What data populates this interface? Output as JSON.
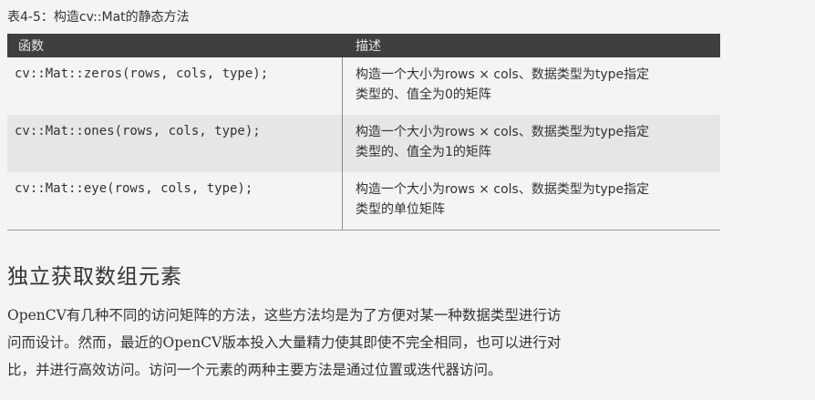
{
  "caption": "表4-5：构造cv::Mat的静态方法",
  "table": {
    "headers": [
      "函数",
      "描述"
    ],
    "rows": [
      {
        "func": "cv::Mat::zeros(rows, cols, type);",
        "desc1": "构造一个大小为rows × cols、数据类型为type指定",
        "desc2": "类型的、值全为0的矩阵"
      },
      {
        "func": "cv::Mat::ones(rows, cols, type);",
        "desc1": "构造一个大小为rows × cols、数据类型为type指定",
        "desc2": "类型的、值全为1的矩阵"
      },
      {
        "func": "cv::Mat::eye(rows, cols, type);",
        "desc1": "构造一个大小为rows × cols、数据类型为type指定",
        "desc2": "类型的单位矩阵"
      }
    ]
  },
  "section_title": "独立获取数组元素",
  "paragraph_lines": [
    "OpenCV有几种不同的访问矩阵的方法，这些方法均是为了方便对某一种数据类型进行访",
    "问而设计。然而，最近的OpenCV版本投入大量精力使其即使不完全相同，也可以进行对",
    "比，并进行高效访问。访问一个元素的两种主要方法是通过位置或迭代器访问。"
  ]
}
